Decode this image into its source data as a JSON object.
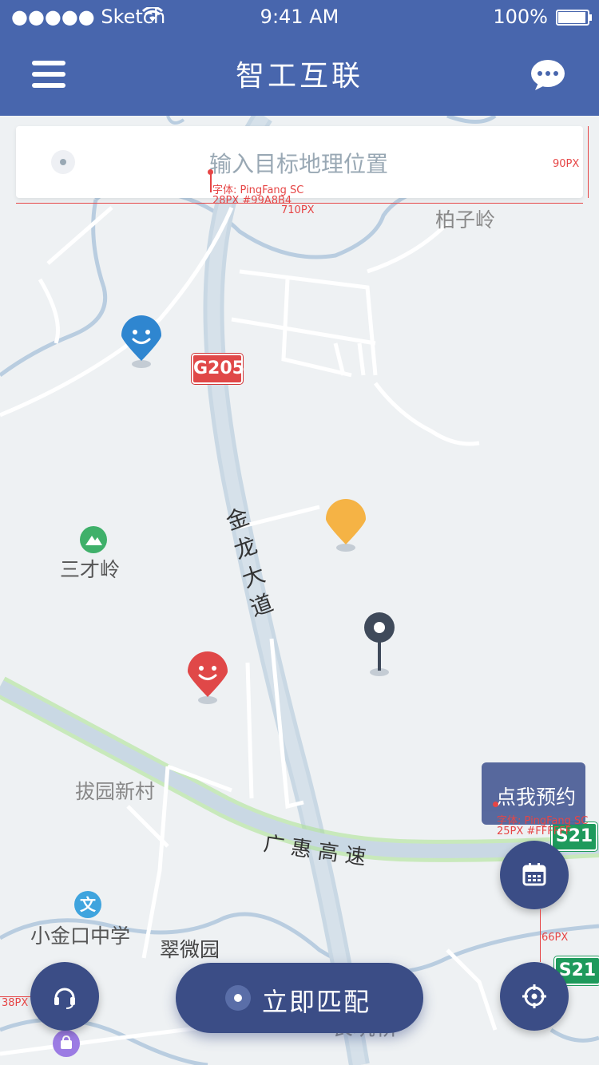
{
  "status_bar": {
    "carrier": "●●●●● Sketch",
    "time": "9:41 AM",
    "battery": "100%",
    "battery_level": 1.0
  },
  "nav": {
    "title": "智工互联"
  },
  "search": {
    "placeholder": "输入目标地理位置",
    "annotation_font": "字体: PingFang SC",
    "annotation_spec": "28PX #99A8B4",
    "annotation_width": "710PX",
    "annotation_height": "90PX"
  },
  "map": {
    "places": {
      "baiziling": "柏子岭",
      "sancailing": "三才岭",
      "bayuanxincun": "拔园新村",
      "xiaojinkou": "小金口中学",
      "cuiweiyuan": "翠微园",
      "changkengqiao": "长坑桥",
      "bottom_partial": "…"
    },
    "roads": {
      "jinlong_1": "金",
      "jinlong_2": "龙",
      "jinlong_3": "大",
      "jinlong_4": "道",
      "guanghui": "广 惠 高 速"
    },
    "shields": {
      "g205": "G205",
      "s21_a": "S21",
      "s21_b": "S21"
    },
    "poi": {
      "school": "文"
    }
  },
  "booking": {
    "label": "点我预约",
    "annotation_font": "字体: PingFang SC",
    "annotation_spec": "25PX #FFFFFF"
  },
  "annotations": {
    "gap": "66PX",
    "side": "38PX"
  },
  "match_button": {
    "label": "立即匹配"
  },
  "colors": {
    "primary": "#4866ad",
    "button_dark": "#3b4d86",
    "placeholder": "#99A8B4",
    "pin_blue": "#2f86d0",
    "pin_orange": "#f5b345",
    "pin_red": "#e04848",
    "pin_dark": "#3f4a5a"
  },
  "icons": {
    "menu": "menu-icon",
    "chat": "chat-bubble-icon",
    "calendar": "calendar-icon",
    "locate": "locate-icon",
    "headset": "headset-icon"
  }
}
